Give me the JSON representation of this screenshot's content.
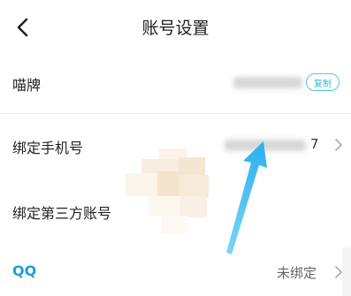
{
  "header": {
    "title": "账号设置",
    "back_icon": "chevron-left-icon"
  },
  "rows": {
    "miaopai": {
      "label": "喵牌",
      "copy_label": "复制"
    },
    "phone": {
      "label": "绑定手机号",
      "visible_tail": "7"
    },
    "third_party": {
      "label": "绑定第三方账号"
    },
    "qq": {
      "label": "QQ",
      "status": "未绑定"
    }
  },
  "colors": {
    "accent": "#39b7d7",
    "qq_blue": "#1f9fd6",
    "arrow": "#3ab8f0"
  },
  "icons": [
    "chevron-left-icon",
    "chevron-right-icon",
    "annotation-arrow-icon"
  ]
}
